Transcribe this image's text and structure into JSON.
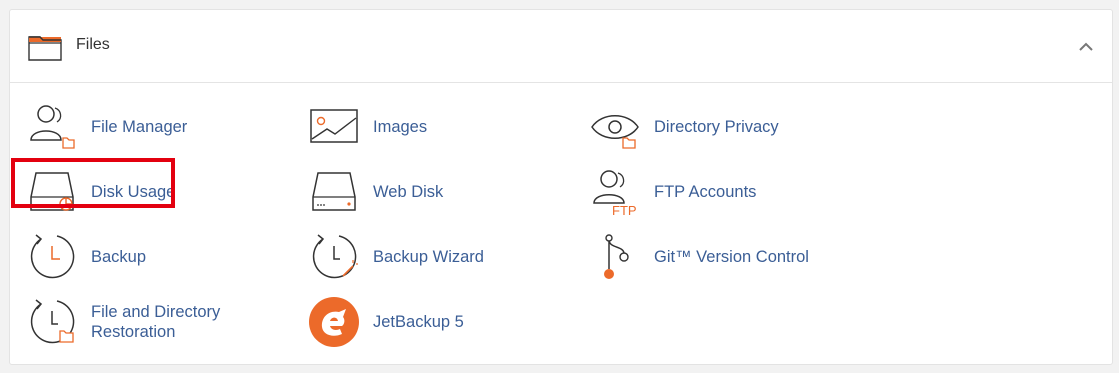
{
  "section": {
    "title": "Files",
    "accent_color": "#ec6a2a"
  },
  "items": [
    {
      "label": "File Manager",
      "icon": "file-manager-icon"
    },
    {
      "label": "Images",
      "icon": "images-icon"
    },
    {
      "label": "Directory Privacy",
      "icon": "directory-privacy-icon"
    },
    {
      "label": "Disk Usage",
      "icon": "disk-usage-icon",
      "highlighted": true
    },
    {
      "label": "Web Disk",
      "icon": "web-disk-icon"
    },
    {
      "label": "FTP Accounts",
      "icon": "ftp-accounts-icon",
      "icon_text": "FTP"
    },
    {
      "label": "Backup",
      "icon": "backup-icon"
    },
    {
      "label": "Backup Wizard",
      "icon": "backup-wizard-icon"
    },
    {
      "label": "Git™ Version Control",
      "icon": "git-icon"
    },
    {
      "label_line1": "File and Directory",
      "label_line2": "Restoration",
      "icon": "restoration-icon"
    },
    {
      "label": "JetBackup 5",
      "icon": "jetbackup-icon"
    }
  ],
  "highlight_color": "#e3000f"
}
